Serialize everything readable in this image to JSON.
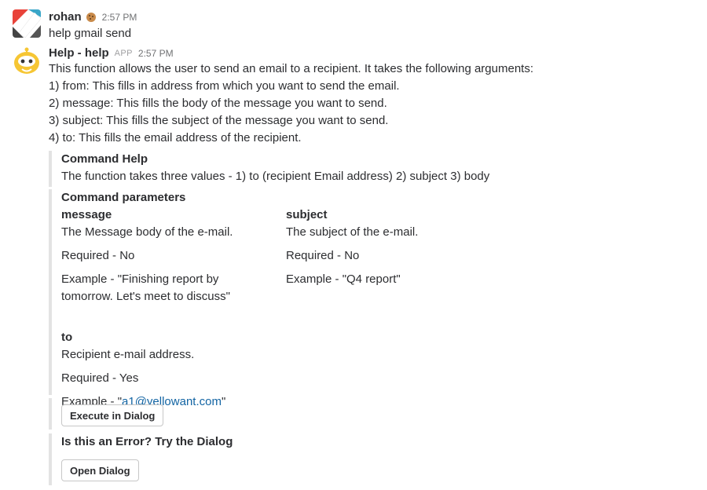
{
  "messages": [
    {
      "sender": "rohan",
      "emoji": "cookie-emoji",
      "time": "2:57 PM",
      "text": "help gmail send"
    },
    {
      "sender": "Help - help",
      "badge": "APP",
      "time": "2:57 PM",
      "lines": [
        "This function allows the user to send an email to a recipient. It takes the following arguments:",
        "1) from: This fills in address from which you want to send the email.",
        "2) message: This fills the body of the message you want to send.",
        "3) subject: This fills the subject of the message you want to send.",
        "4) to: This fills the email address of the recipient."
      ]
    }
  ],
  "command_help": {
    "title": "Command Help",
    "text": "The function takes three values - 1) to (recipient Email address) 2) subject 3) body"
  },
  "command_parameters": {
    "title": "Command parameters",
    "params": [
      {
        "name": "message",
        "description": "The Message body of the e-mail.",
        "required": "Required - No",
        "example_line1": "Example - \"Finishing report by",
        "example_line2": "tomorrow. Let's meet to discuss\""
      },
      {
        "name": "subject",
        "description": "The subject of the e-mail.",
        "required": "Required - No",
        "example_line1": "Example - \"Q4 report\""
      },
      {
        "name": "to",
        "description": "Recipient e-mail address.",
        "required": "Required - Yes",
        "example_prefix": "Example - \"",
        "example_link": "a1@yellowant.com",
        "example_suffix": "\""
      }
    ]
  },
  "actions": {
    "execute_label": "Execute in Dialog",
    "error_title": "Is this an Error? Try the Dialog",
    "open_label": "Open Dialog"
  },
  "colors": {
    "link": "#1264a3",
    "attachment_border": "#e3e3e3",
    "bot_avatar": "#f6c634"
  }
}
